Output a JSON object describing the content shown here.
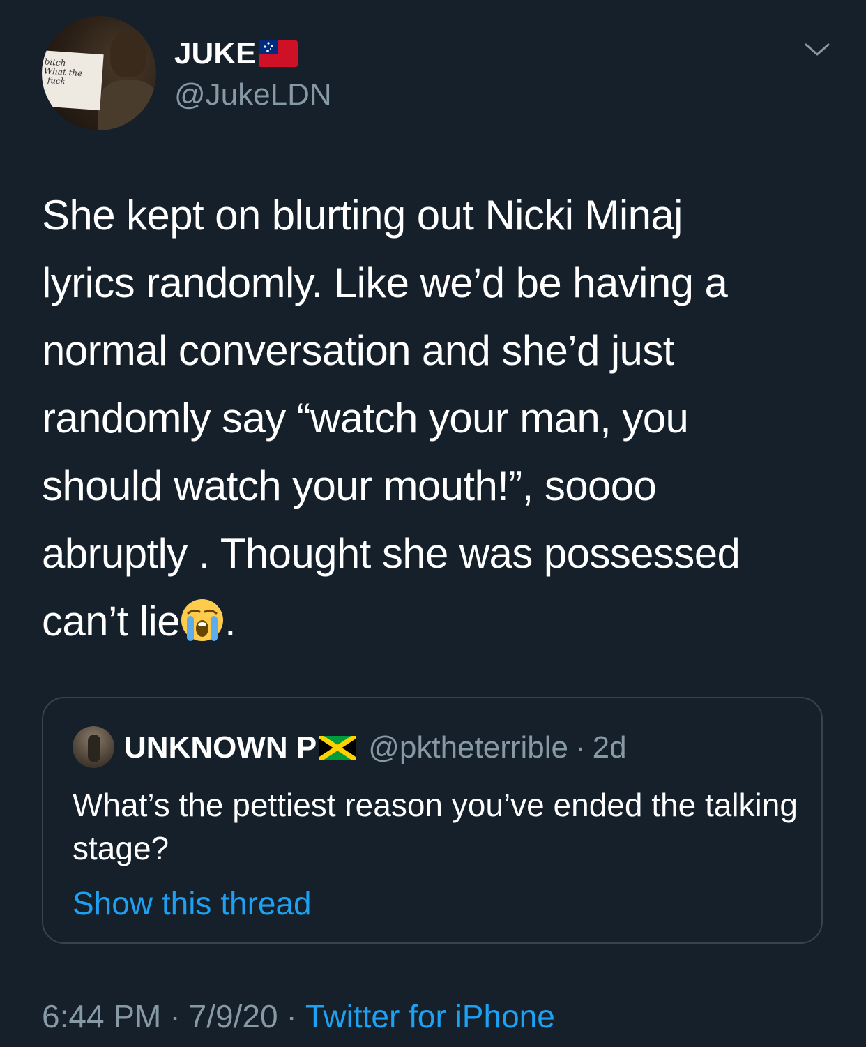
{
  "tweet": {
    "author": {
      "name": "JUKE",
      "handle": "@JukeLDN",
      "avatar_sign_text": [
        "bitch",
        "What the",
        "fuck"
      ],
      "flag_icon": "samoa-flag-icon"
    },
    "menu_icon": "chevron-down-icon",
    "text_lines": [
      "She kept on blurting out Nicki Minaj",
      "lyrics randomly. Like we’d be having a",
      "normal conversation and she’d just",
      "randomly say “watch your man, you",
      "should watch your mouth!”, soooo",
      "abruptly . Thought she was possessed",
      "can’t lie"
    ],
    "text_end": ".",
    "emoji": "loudly-crying-face-emoji",
    "timestamp": {
      "time": "6:44 PM",
      "separator": "·",
      "date": "7/9/20",
      "source": "Twitter for iPhone"
    }
  },
  "quoted_tweet": {
    "name": "UNKNOWN P",
    "flag_icon": "jamaica-flag-icon",
    "handle": "@pktheterrible",
    "separator": "·",
    "age": "2d",
    "text": "What’s the pettiest reason you’ve ended the talking stage?",
    "show_thread_label": "Show this thread"
  },
  "colors": {
    "background": "#15202b",
    "text_primary": "#ffffff",
    "text_secondary": "#8899a6",
    "link": "#1da1f2",
    "border": "#38444d"
  }
}
